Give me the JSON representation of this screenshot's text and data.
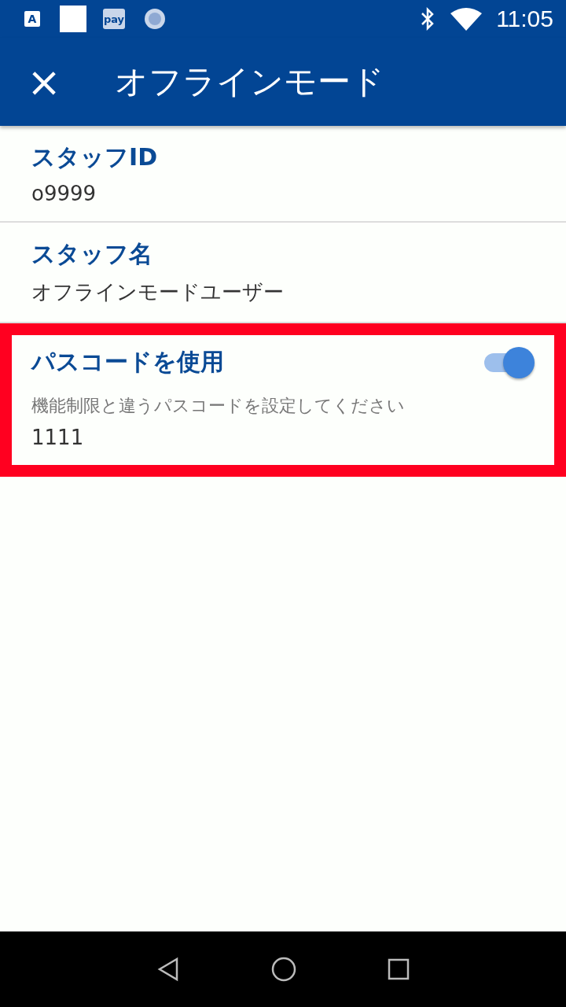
{
  "status_bar": {
    "notification_icons": [
      {
        "kind": "app",
        "label": "A"
      },
      {
        "kind": "blank"
      },
      {
        "kind": "pay",
        "label": "pay"
      },
      {
        "kind": "loading"
      }
    ],
    "time": "11:05"
  },
  "app_bar": {
    "close": "×",
    "title": "オフラインモード"
  },
  "settings": [
    {
      "kind": "info",
      "label": "スタッフID",
      "value": "o9999",
      "highlighted": false
    },
    {
      "kind": "info",
      "label": "スタッフ名",
      "value": "オフラインモードユーザー",
      "highlighted": false
    },
    {
      "kind": "toggle",
      "label": "パスコードを使用",
      "on": true,
      "hint": "機能制限と違うパスコードを設定してください",
      "value": "1111",
      "highlighted": true
    }
  ]
}
